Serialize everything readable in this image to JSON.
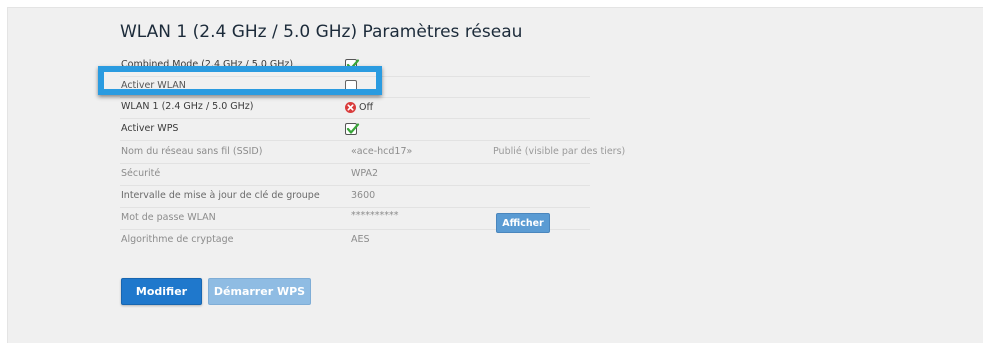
{
  "page": {
    "title": "WLAN 1 (2.4 GHz / 5.0 GHz) Paramètres réseau"
  },
  "settings": {
    "combined_mode": {
      "label": "Combined Mode (2.4 GHz / 5.0 GHz)",
      "checked": true
    },
    "enable_wlan": {
      "label": "Activer WLAN",
      "checked": false
    },
    "wlan1_status": {
      "label": "WLAN 1 (2.4 GHz / 5.0 GHz)",
      "value": "Off",
      "icon": "off-status-icon",
      "color": "#d93b3b"
    },
    "enable_wps": {
      "label": "Activer WPS",
      "checked": true
    },
    "ssid": {
      "label": "Nom du réseau sans fil (SSID)",
      "value": "«ace-hcd17»",
      "visibility": "Publié (visible par des tiers)"
    },
    "security": {
      "label": "Sécurité",
      "value": "WPA2"
    },
    "group_key_interval": {
      "label": "Intervalle de mise à jour de clé de groupe",
      "value": "3600"
    },
    "wlan_password": {
      "label": "Mot de passe WLAN",
      "value": "**********",
      "show_label": "Afficher"
    },
    "encryption": {
      "label": "Algorithme de cryptage",
      "value": "AES"
    }
  },
  "actions": {
    "modify_label": "Modifier",
    "start_wps_label": "Démarrer WPS"
  },
  "colors": {
    "primary_button": "#1f78cc",
    "secondary_button": "#8fbce3",
    "highlight_box": "#2a9be0",
    "check_green": "#3aa53a"
  }
}
